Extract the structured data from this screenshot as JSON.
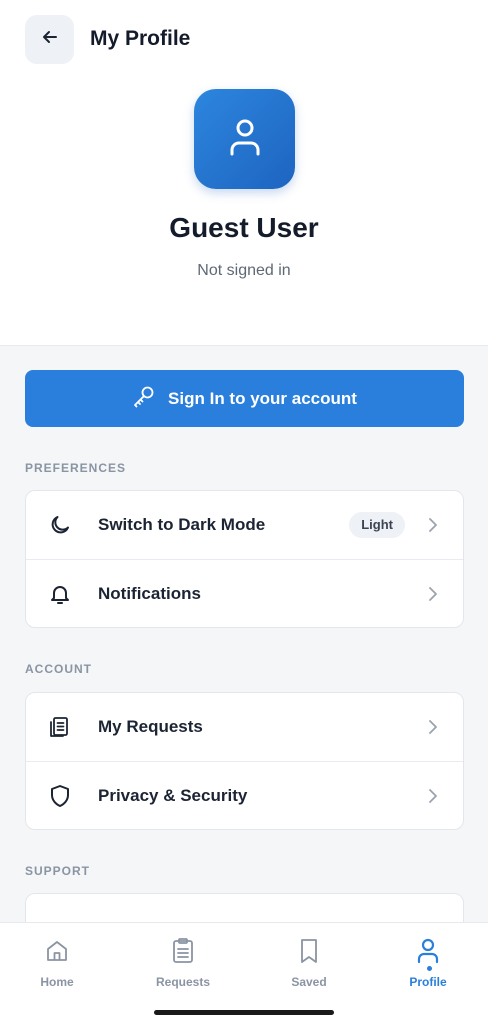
{
  "header": {
    "title": "My Profile",
    "back_icon": "arrow-left-icon"
  },
  "profile": {
    "name": "Guest User",
    "status": "Not signed in",
    "avatar_icon": "user-icon"
  },
  "signin": {
    "label": "Sign In to your account",
    "icon": "key-icon"
  },
  "preferences": {
    "label": "PREFERENCES",
    "items": [
      {
        "label": "Switch to Dark Mode",
        "icon": "moon-icon",
        "badge": "Light"
      },
      {
        "label": "Notifications",
        "icon": "bell-icon"
      }
    ]
  },
  "account": {
    "label": "ACCOUNT",
    "items": [
      {
        "label": "My Requests",
        "icon": "clipboard-icon"
      },
      {
        "label": "Privacy & Security",
        "icon": "shield-icon"
      }
    ]
  },
  "support": {
    "label": "SUPPORT"
  },
  "tabs": [
    {
      "label": "Home",
      "icon": "home-icon",
      "active": false
    },
    {
      "label": "Requests",
      "icon": "clipboard-icon",
      "active": false
    },
    {
      "label": "Saved",
      "icon": "bookmark-icon",
      "active": false
    },
    {
      "label": "Profile",
      "icon": "user-icon",
      "active": true
    }
  ],
  "colors": {
    "accent": "#2a7fdc",
    "text": "#1c2433",
    "muted": "#8a94a3",
    "background": "#f4f6f8"
  }
}
